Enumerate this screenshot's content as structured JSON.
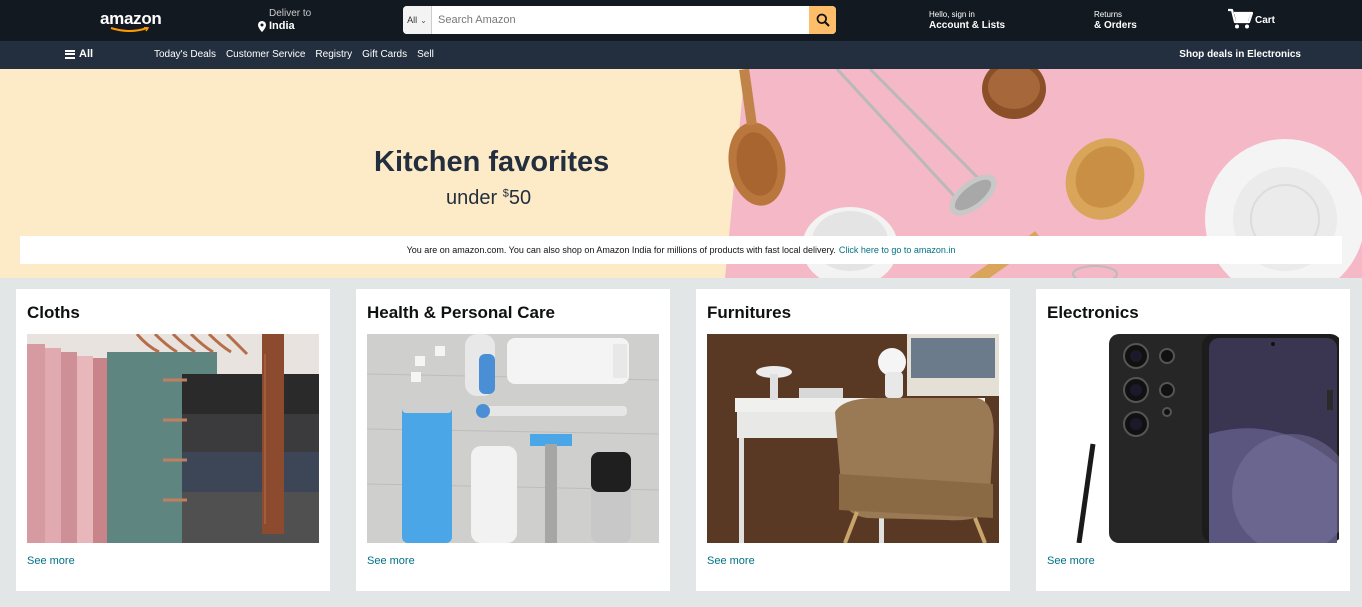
{
  "header": {
    "logo": "amazon",
    "deliver_to": "Deliver to",
    "location": "India",
    "search_category": "All",
    "search_placeholder": "Search Amazon",
    "account_greeting": "Hello, sign in",
    "account_label": "Account & Lists",
    "returns_label": "Returns",
    "orders_label": "& Orders",
    "cart_label": "Cart"
  },
  "subnav": {
    "all_label": "All",
    "links": [
      "Today's Deals",
      "Customer Service",
      "Registry",
      "Gift Cards",
      "Sell"
    ],
    "promo": "Shop deals in Electronics"
  },
  "hero": {
    "title": "Kitchen favorites",
    "subtitle_prefix": "under ",
    "currency": "$",
    "amount": "50",
    "notice_text": "You are on amazon.com. You can also shop on Amazon India for millions of products with fast local delivery.",
    "notice_link": "Click here to go to amazon.in"
  },
  "cards": [
    {
      "title": "Cloths",
      "link": "See more"
    },
    {
      "title": "Health & Personal Care",
      "link": "See more"
    },
    {
      "title": "Furnitures",
      "link": "See more"
    },
    {
      "title": "Electronics",
      "link": "See more"
    }
  ],
  "colors": {
    "nav_bg": "#131921",
    "subnav_bg": "#232f3e",
    "search_button": "#febd69",
    "link": "#007185",
    "hero_cream": "#fdebc8",
    "hero_pink": "#f5b8c7"
  }
}
